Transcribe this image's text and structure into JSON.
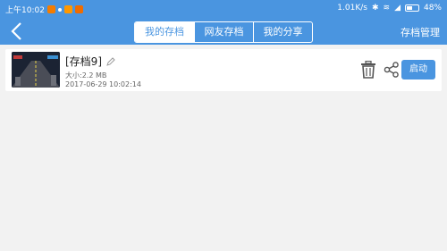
{
  "status": {
    "time": "上午10:02",
    "speed": "1.01K/s",
    "battery": "48%",
    "battery_level": 0.48
  },
  "header": {
    "tabs": [
      {
        "label": "我的存档",
        "active": true
      },
      {
        "label": "网友存档",
        "active": false
      },
      {
        "label": "我的分享",
        "active": false
      }
    ],
    "manage_label": "存档管理"
  },
  "save": {
    "title": "[存档9]",
    "size": "大小:2.2 MB",
    "date": "2017-06-29 10:02:14",
    "launch_label": "启动"
  },
  "colors": {
    "accent": "#4a95e0",
    "background": "#f2f2f2"
  }
}
